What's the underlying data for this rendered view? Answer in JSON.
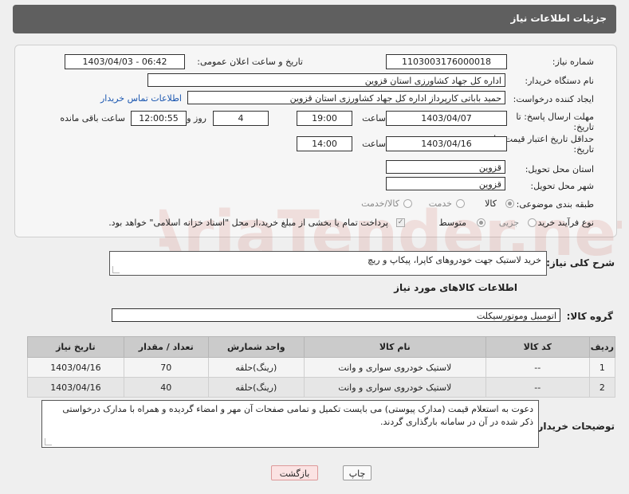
{
  "header": {
    "title": "جزئیات اطلاعات نیاز"
  },
  "form": {
    "need_number": {
      "label": "شماره نیاز:",
      "value": "1103003176000018"
    },
    "announce_datetime": {
      "label": "تاریخ و ساعت اعلان عمومی:",
      "value": "1403/04/03 - 06:42"
    },
    "buyer_org": {
      "label": "نام دستگاه خریدار:",
      "value": "اداره کل جهاد کشاورزی استان قزوین"
    },
    "requester": {
      "label": "ایجاد کننده درخواست:",
      "value": "حمید باباتی کارپرداز اداره کل جهاد کشاورزی استان قزوین",
      "contact_link": "اطلاعات تماس خریدار"
    },
    "reply_deadline": {
      "label_line1": "مهلت ارسال پاسخ: تا",
      "label_line2": "تاریخ:",
      "date": "1403/04/07",
      "time_label": "ساعت",
      "time": "19:00",
      "days": "4",
      "days_label": "روز و",
      "remaining": "12:00:55",
      "remaining_label": "ساعت باقی مانده"
    },
    "price_validity": {
      "label_line1": "حداقل تاریخ اعتبار قیمت: تا",
      "label_line2": "تاریخ:",
      "date": "1403/04/16",
      "time_label": "ساعت",
      "time": "14:00"
    },
    "delivery_province": {
      "label": "استان محل تحویل:",
      "value": "قزوین"
    },
    "delivery_city": {
      "label": "شهر محل تحویل:",
      "value": "قزوین"
    },
    "category": {
      "label": "طبقه بندی موضوعی:",
      "options": [
        "کالا",
        "خدمت",
        "کالا/خدمت"
      ],
      "selected": "کالا"
    },
    "process_type": {
      "label": "نوع فرآیند خرید :",
      "options": [
        "جزیی",
        "متوسط"
      ],
      "selected": "متوسط",
      "payment_note": "پرداخت تمام یا بخشی از مبلغ خرید،از محل \"اسناد خزانه اسلامی\" خواهد بود."
    }
  },
  "description": {
    "label": "شرح کلی نیاز:",
    "value": "خرید لاستیک جهت خودروهای کاپرا، پیکاپ و ریچ"
  },
  "goods": {
    "title": "اطلاعات کالاهای مورد نیاز",
    "group_label": "گروه کالا:",
    "group_value": "اتومبیل وموتورسیکلت",
    "columns": [
      "ردیف",
      "کد کالا",
      "نام کالا",
      "واحد شمارش",
      "تعداد / مقدار",
      "تاریخ نیاز"
    ],
    "rows": [
      [
        "1",
        "--",
        "لاستیک خودروی سواری و وانت",
        "(رینگ)حلقه",
        "70",
        "1403/04/16"
      ],
      [
        "2",
        "--",
        "لاستیک خودروی سواری و وانت",
        "(رینگ)حلقه",
        "40",
        "1403/04/16"
      ]
    ]
  },
  "buyer_notes": {
    "label": "توضیحات خریدار:",
    "value": "دعوت به استعلام قیمت (مدارک پیوستی) می بایست تکمیل و تمامی صفحات آن مهر و امضاء گردیده و همراه با مدارک درخواستی ذکر شده در آن در سامانه بارگذاری گردند."
  },
  "buttons": {
    "print": "چاپ",
    "back": "بازگشت"
  },
  "watermark": {
    "text": "AriaTender.net"
  }
}
